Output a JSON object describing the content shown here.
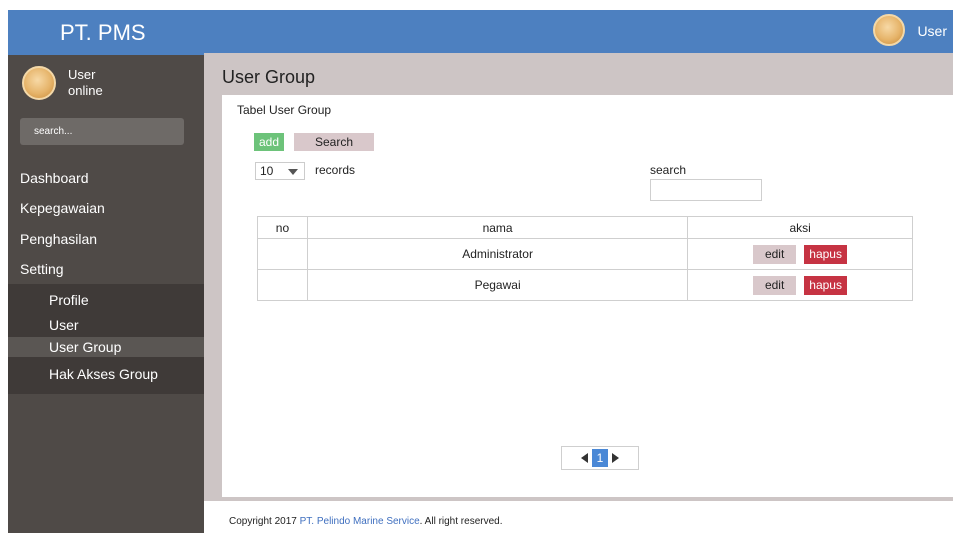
{
  "app": {
    "brand": "PT. PMS"
  },
  "colors": {
    "accent": "#4d80c0",
    "sidebar": "#4f4a47",
    "add": "#6dc37a",
    "hapus": "#c63343",
    "page_active": "#4a88d6"
  },
  "header": {
    "user_label": "User",
    "avatar_icon": "user-avatar-icon"
  },
  "sidebar": {
    "user": {
      "name": "User",
      "status": "online"
    },
    "search_placeholder": "search...",
    "menu": [
      {
        "label": "Dashboard"
      },
      {
        "label": "Kepegawaian"
      },
      {
        "label": "Penghasilan"
      },
      {
        "label": "Setting"
      }
    ],
    "submenu": [
      {
        "label": "Profile"
      },
      {
        "label": "User"
      },
      {
        "label": "User Group",
        "active": true
      },
      {
        "label": "Hak Akses Group"
      }
    ]
  },
  "main": {
    "title": "User Group",
    "card_title": "Tabel User Group",
    "add_label": "add",
    "search_button_label": "Search",
    "records_value": "10",
    "records_label": "records",
    "search_label": "search",
    "table": {
      "headers": [
        "no",
        "nama",
        "aksi"
      ],
      "rows": [
        {
          "no": "",
          "nama": "Administrator",
          "edit": "edit",
          "hapus": "hapus"
        },
        {
          "no": "",
          "nama": "Pegawai",
          "edit": "edit",
          "hapus": "hapus"
        }
      ]
    },
    "pagination": {
      "current": "1"
    }
  },
  "footer": {
    "prefix": "Copyright 2017",
    "company": "PT. Pelindo Marine Service",
    "suffix": ". All right reserved."
  }
}
